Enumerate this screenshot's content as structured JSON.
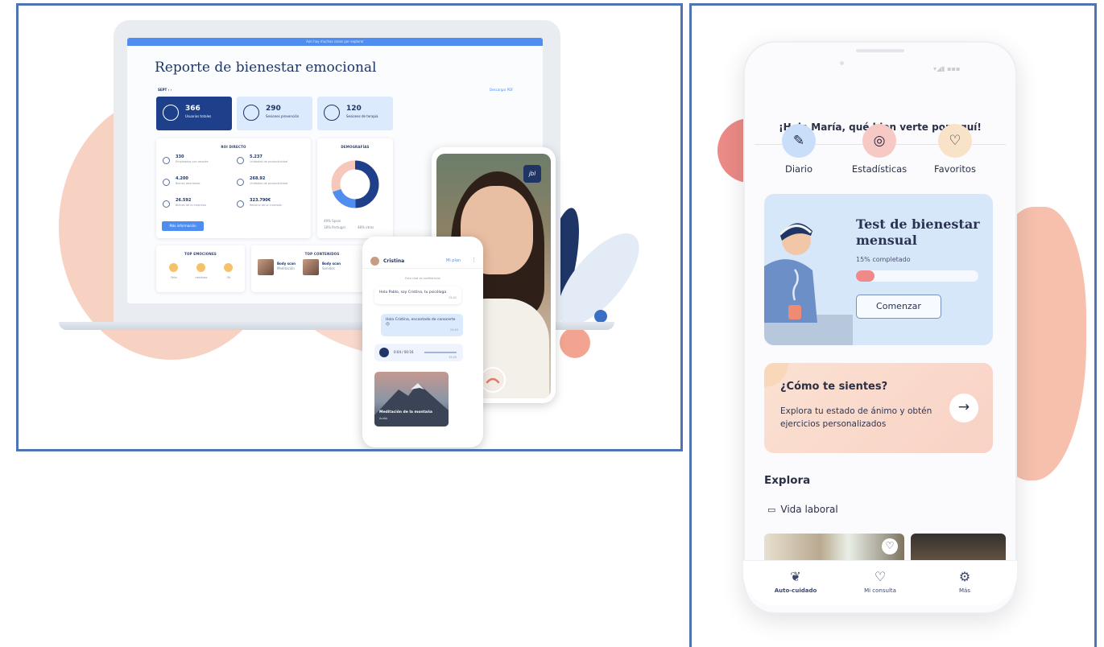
{
  "dashboard": {
    "topbar": "Aún hay muchas cosas por explorar",
    "title": "Reporte de bienestar emocional",
    "period": "SEPT",
    "download": "Descargar PDF",
    "stats": [
      {
        "value": "366",
        "label": "Usuarios totales"
      },
      {
        "value": "290",
        "label": "Sesiones prevención"
      },
      {
        "value": "120",
        "label": "Sesiones de terapia"
      }
    ],
    "roi": {
      "heading": "ROI DIRECTO",
      "items": [
        {
          "value": "330",
          "desc": "Empleados con reporte"
        },
        {
          "value": "5.237",
          "desc": "Unidades de productividad"
        },
        {
          "value": "4.200",
          "desc": "Bienes ahorrados"
        },
        {
          "value": "268.92",
          "desc": "Unidades de productividad"
        },
        {
          "value": "26.592",
          "desc": "Bienes de la empresa"
        },
        {
          "value": "323.790€",
          "desc": "Retorno de la inversión"
        }
      ],
      "button": "Más información"
    },
    "demographics": {
      "heading": "DEMOGRAFÍAS",
      "legend": [
        "49% Spain",
        "18% Portugal",
        "48% otros"
      ]
    },
    "emotions": {
      "heading": "TOP EMOCIONES",
      "items": [
        "Feliz",
        "nervioso",
        "Ok"
      ]
    },
    "contents": {
      "heading": "TOP CONTENIDOS",
      "items": [
        {
          "title": "Body scan",
          "sub": "Meditación"
        },
        {
          "title": "Body scan",
          "sub": "Sonidos"
        }
      ]
    }
  },
  "video_call": {
    "badge": "jbl"
  },
  "chat": {
    "contact": "Cristina",
    "plan": "Mi plan",
    "notice": "Este chat es confidencial",
    "messages": [
      {
        "text": "Hola Pablo, soy Cristina, tu psicóloga",
        "time": "15:42"
      },
      {
        "text": "Hola Cristina, encantado de conocerte",
        "time": "15:43"
      }
    ],
    "audio_time": "0:04 / 00:16",
    "audio_stamp": "15:45",
    "card_title": "Meditación de la montaña",
    "card_sub": "Audio"
  },
  "app": {
    "greeting": "¡Hola María, qué bien verte por aquí!",
    "quick_actions": [
      {
        "label": "Diario",
        "icon": "diary-icon",
        "color": "#c9def8",
        "glyph": "✎"
      },
      {
        "label": "Estadísticas",
        "icon": "stats-icon",
        "color": "#f7c9c4",
        "glyph": "◎"
      },
      {
        "label": "Favoritos",
        "icon": "heart-icon",
        "color": "#f9e3c8",
        "glyph": "♡"
      }
    ],
    "test_card": {
      "title": "Test de bienestar mensual",
      "progress_label": "15% completado",
      "progress": 0.15,
      "button": "Comenzar"
    },
    "mood_card": {
      "title": "¿Cómo te sientes?",
      "subtitle": "Explora tu estado de ánimo y obtén ejercicios personalizados"
    },
    "explore": {
      "title": "Explora",
      "category": "Vida laboral"
    },
    "tabs": [
      {
        "label": "Auto-cuidado",
        "icon": "leaf-icon",
        "glyph": "❦"
      },
      {
        "label": "Mi consulta",
        "icon": "consult-heart-icon",
        "glyph": "♡"
      },
      {
        "label": "Más",
        "icon": "gear-icon",
        "glyph": "⚙"
      }
    ],
    "colors": {
      "accent": "#1e3566",
      "brand_blue": "#4f8ef0",
      "progress": "#f08a8a"
    }
  }
}
